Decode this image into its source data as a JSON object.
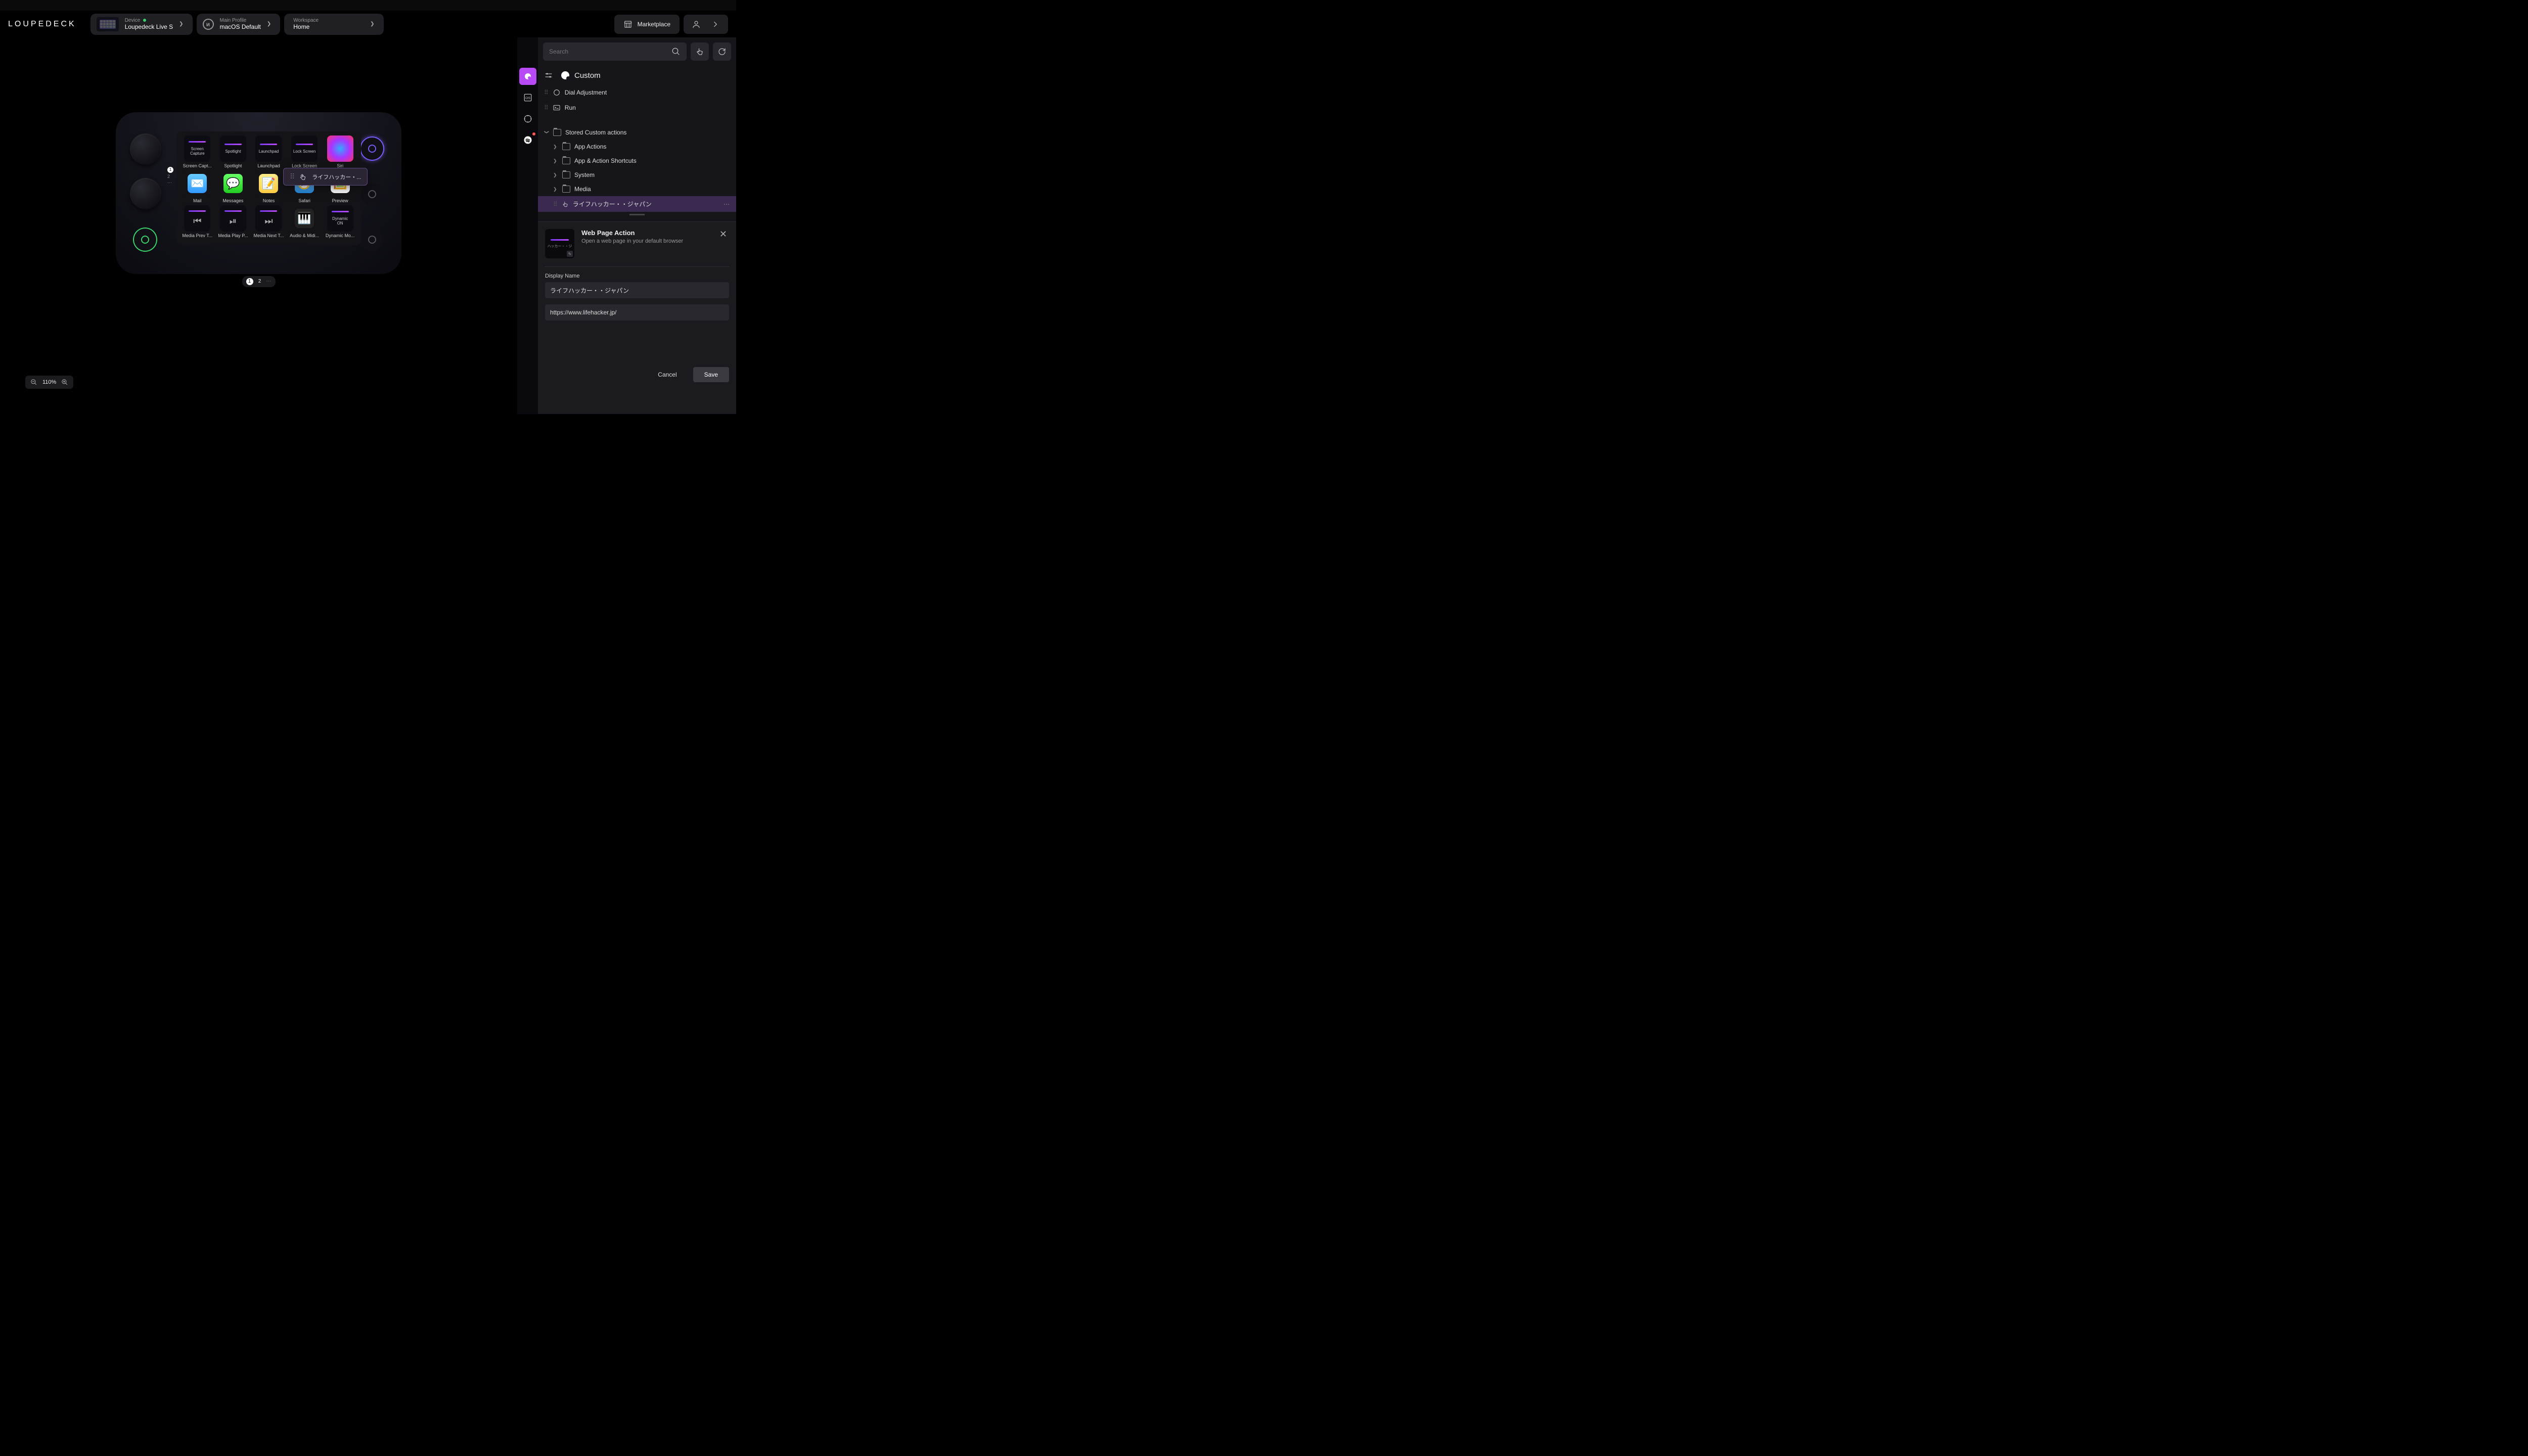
{
  "header": {
    "logo": "LOUPEDECK",
    "device_label": "Device",
    "device_name": "Loupedeck Live S",
    "profile_label": "Main Profile",
    "profile_name": "macOS Default",
    "workspace_label": "Workspace",
    "workspace_name": "Home",
    "marketplace": "Marketplace"
  },
  "search": {
    "placeholder": "Search"
  },
  "panel": {
    "title": "Custom",
    "items": {
      "dial": "Dial Adjustment",
      "run": "Run",
      "stored": "Stored Custom actions",
      "app_actions": "App Actions",
      "shortcuts": "App & Action Shortcuts",
      "system": "System",
      "media": "Media",
      "lifehacker": "ライフハッカー・・ジャパン"
    }
  },
  "butt": {
    "r1c1": "Screen Capture",
    "r1c1s": "Screen Capt...",
    "r1c2": "Spotlight",
    "r1c3": "Launchpad",
    "r1c4": "Lock Screen",
    "r1c5": "Siri",
    "r2c1": "Mail",
    "r2c2": "Messages",
    "r2c3": "Notes",
    "r2c4": "Safari",
    "r2c5": "Preview",
    "r3c1": "Media Prev T...",
    "r3c2": "Media Play P...",
    "r3c3": "Media Next T...",
    "r3c4": "Audio & Midi...",
    "r3c5": "Dynamic Mo...",
    "dyn1": "Dynamic",
    "dyn2": "ON"
  },
  "pages": {
    "p1": "1",
    "p2": "2"
  },
  "drag": {
    "label": "ライフハッカー・..."
  },
  "zoom": {
    "value": "110%"
  },
  "action": {
    "title": "Web Page Action",
    "subtitle": "Open a web page in your default browser",
    "thumb_text": "ハッカー・・ジ",
    "display_name_label": "Display Name",
    "display_name_value": "ライフハッカー・・ジャパン",
    "url_value": "https://www.lifehacker.jp/",
    "cancel": "Cancel",
    "save": "Save"
  }
}
